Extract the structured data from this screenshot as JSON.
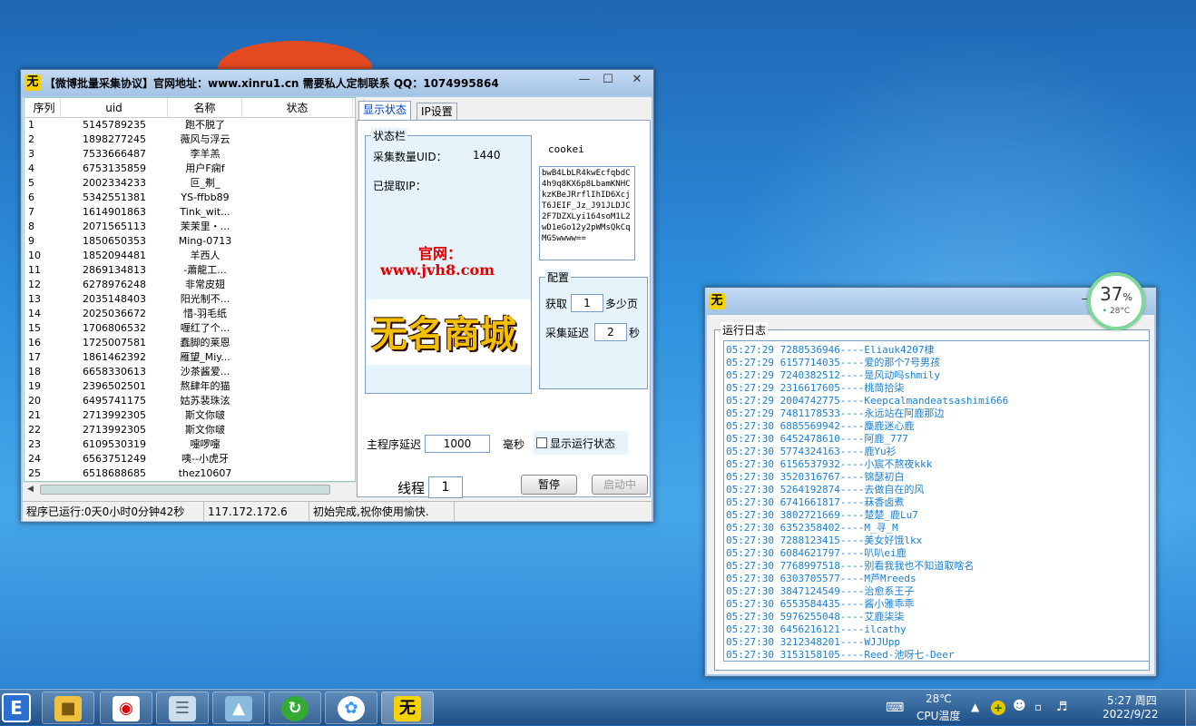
{
  "main_window": {
    "title": "【微博批量采集协议】官网地址：www.xinru1.cn   需要私人定制联系 QQ：1074995864",
    "list": {
      "headers": [
        "序列",
        "uid",
        "名称",
        "状态"
      ],
      "rows": [
        [
          "1",
          "5145789235",
          "跑不脱了"
        ],
        [
          "2",
          "1898277245",
          "薇风与浮云"
        ],
        [
          "3",
          "7533666487",
          "李羊羔"
        ],
        [
          "4",
          "6753135859",
          "用户F痫f"
        ],
        [
          "5",
          "2002334233",
          "叵_刜_"
        ],
        [
          "6",
          "5342551381",
          "YS-ffbb89"
        ],
        [
          "7",
          "1614901863",
          "Tink_wit..."
        ],
        [
          "8",
          "2071565113",
          "茉茉里・..."
        ],
        [
          "9",
          "1850650353",
          "Ming-0713"
        ],
        [
          "10",
          "1852094481",
          "羊西人"
        ],
        [
          "11",
          "2869134813",
          "-蕭龍工..."
        ],
        [
          "12",
          "6278976248",
          "非常皮翅"
        ],
        [
          "13",
          "2035148403",
          "阳光制不..."
        ],
        [
          "14",
          "2025036672",
          "惜-羽毛纸"
        ],
        [
          "15",
          "1706806532",
          "喱红了个..."
        ],
        [
          "16",
          "1725007581",
          "蠢脚的莱恩"
        ],
        [
          "17",
          "1861462392",
          "雁望_Miy..."
        ],
        [
          "18",
          "6658330613",
          "沙茶酱爱..."
        ],
        [
          "19",
          "2396502501",
          "熬肆年的猫"
        ],
        [
          "20",
          "6495741175",
          "姑苏裴珠泫"
        ],
        [
          "21",
          "2713992305",
          "斯文你啵"
        ],
        [
          "22",
          "2713992305",
          "斯文你啵"
        ],
        [
          "23",
          "6109530319",
          "嚏啰嚏"
        ],
        [
          "24",
          "6563751249",
          "咦--小虎牙"
        ],
        [
          "25",
          "6518688685",
          "thez10607"
        ]
      ]
    },
    "tabs": [
      "显示状态",
      "IP设置"
    ],
    "status_group": {
      "label": "状态栏",
      "uid_count_label": "采集数量UID：",
      "uid_count_value": "1440",
      "ip_label": "已提取IP：",
      "site_label": "官网：",
      "site_url": "www.jvh8.com",
      "logo_text": "无名商城"
    },
    "cookie": {
      "label": "cookei",
      "value": "bwB4LbLR4kwEcfqbdC4h9q8KX6p8LbamKNHCkzKBeJRrflIhID6XcjT6JEIF_Jz_J91JLDJC2F7DZXLyi164soM1L2wD1eGo12y2pWMsQkCqMGSwwww=="
    },
    "config": {
      "label": "配置",
      "fetch_label": "获取",
      "fetch_value": "1",
      "fetch_unit": "多少页",
      "delay_label": "采集延迟",
      "delay_value": "2",
      "delay_unit": "秒"
    },
    "main_delay_label": "主程序延迟",
    "main_delay_value": "1000",
    "main_delay_unit": "毫秒",
    "show_status_label": "显示运行状态",
    "thread_label": "线程",
    "thread_value": "1",
    "pause_button": "暂停",
    "start_button": "启动中",
    "statusbar": [
      "程序已运行:0天0小时0分钟42秒",
      "117.172.172.6",
      "初始完成,祝你使用愉快."
    ]
  },
  "log_window": {
    "group_label": "运行日志",
    "lines": [
      "05:27:29 7288536946----Eliauk4207棣",
      "05:27:29 6157714035----爱的那个7号男孩",
      "05:27:29 7240382512----是风动吗shmily",
      "05:27:29 2316617605----桃茼拾柒",
      "05:27:29 2004742775----Keepcalmandeatsashimi666",
      "05:27:29 7481178533----永远站在阿鹿那边",
      "05:27:30 6885569942----麋鹿迷心鹿",
      "05:27:30 6452478610----阿鹿_777",
      "05:27:30 5774324163----鹿Yu衫",
      "05:27:30 6156537932----小宸不熬夜kkk",
      "05:27:30 3520316767----锦瑟初白",
      "05:27:30 5264192874----去做自在的风",
      "05:27:30 6741661817----菻香卤煮",
      "05:27:30 3802721669----楚楚_鹿Lu7",
      "05:27:30 6352358402----M_寻_M",
      "05:27:30 7288123415----美女好饿lkx",
      "05:27:30 6084621797----叭叭ei鹿",
      "05:27:30 7768997518----别看我我也不知道取啥名",
      "05:27:30 6303705577----M芦Mreeds",
      "05:27:30 3847124549----治愈系王子",
      "05:27:30 6553584435----酱小雅乖乖",
      "05:27:30 5976255048----艾鹿柒柒",
      "05:27:30 6456216121----ilcathy",
      "05:27:30 3212348201----WJJUpp",
      "05:27:30 3153158105----Reed-池呀七-Deer"
    ]
  },
  "gauge": {
    "percent": "37",
    "unit": "%",
    "temp": "28°C"
  },
  "taskbar": {
    "temp": "28℃",
    "temp_label": "CPU温度",
    "time": "5:27 周四",
    "date": "2022/9/22"
  }
}
